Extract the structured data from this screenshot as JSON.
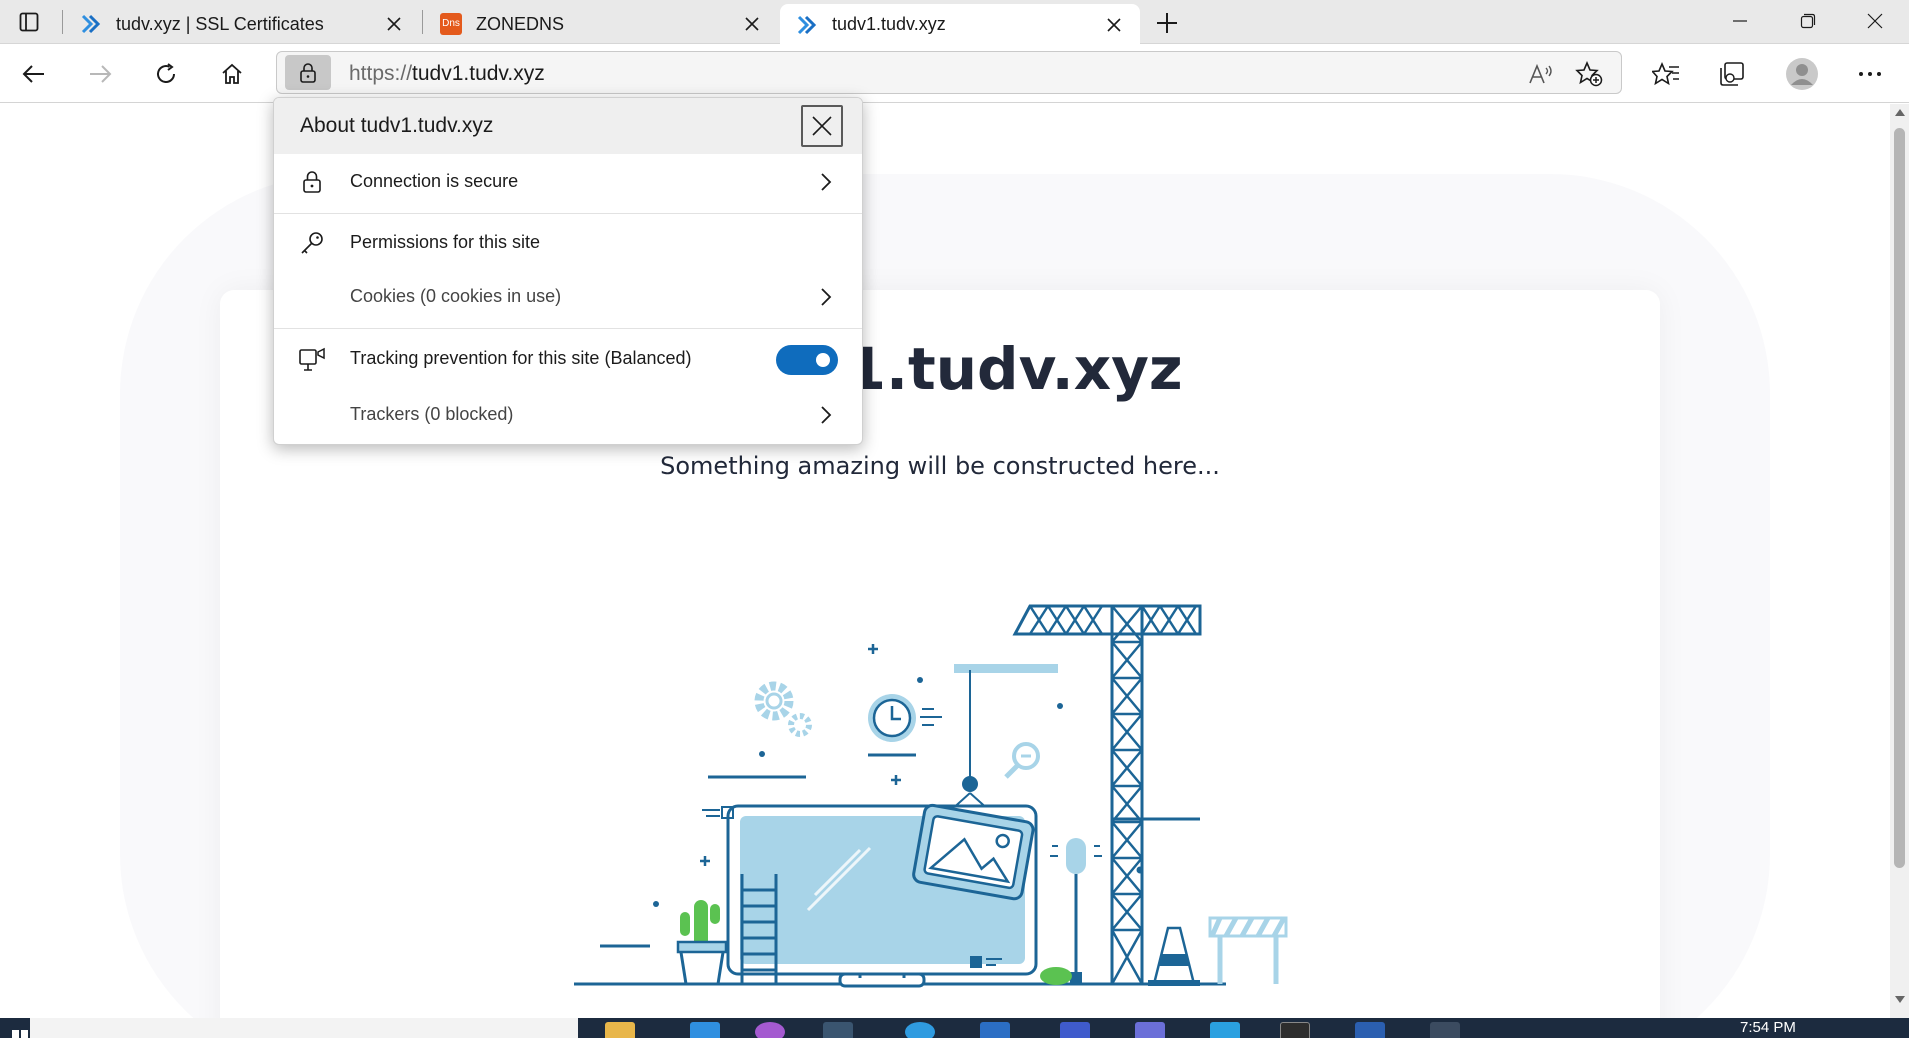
{
  "browser": {
    "tabs": [
      {
        "title": "tudv.xyz | SSL Certificates",
        "favicon": "blue-chevron-icon",
        "active": false
      },
      {
        "title": "ZONEDNS",
        "favicon": "dns-icon",
        "favicon_text": "Dns",
        "active": false
      },
      {
        "title": "tudv1.tudv.xyz",
        "favicon": "blue-chevron-icon",
        "active": true
      }
    ],
    "address": {
      "protocol": "https://",
      "host": "tudv1.tudv.xyz"
    }
  },
  "popup": {
    "title": "About tudv1.tudv.xyz",
    "connection": "Connection is secure",
    "permissions": "Permissions for this site",
    "cookies": "Cookies (0 cookies in use)",
    "tracking": "Tracking prevention for this site (Balanced)",
    "tracking_enabled": true,
    "trackers": "Trackers (0 blocked)"
  },
  "page": {
    "heading": "tudv1.tudv.xyz",
    "subheading": "Something amazing will be constructed here..."
  },
  "taskbar": {
    "clock": "7:54 PM"
  },
  "colors": {
    "accent": "#0f6cbd",
    "illustration_dark": "#1c6596",
    "illustration_light": "#a8d4e8",
    "taskbar": "#1c2b3f"
  }
}
